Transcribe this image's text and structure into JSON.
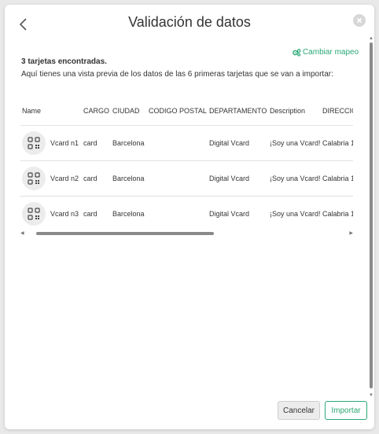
{
  "modal": {
    "title": "Validación de datos",
    "remap_label": "Cambiar mapeo",
    "found_text": "3 tarjetas encontradas.",
    "preview_text": "Aquí tienes una vista previa de los datos de las 6 primeras tarjetas que se van a importar:"
  },
  "table": {
    "headers": [
      "Name",
      "CARGO",
      "CIUDAD",
      "CODIGO POSTAL",
      "DEPARTAMENTO",
      "Description",
      "DIRECCIÓN"
    ],
    "rows": [
      {
        "name": "Vcard n1",
        "cargo": "card",
        "ciudad": "Barcelona",
        "cp": "",
        "departamento": "Digital Vcard",
        "description": "¡Soy una Vcard!",
        "direccion": "Calabria 1"
      },
      {
        "name": "Vcard n2",
        "cargo": "card",
        "ciudad": "Barcelona",
        "cp": "",
        "departamento": "Digital Vcard",
        "description": "¡Soy una Vcard!",
        "direccion": "Calabria 1"
      },
      {
        "name": "Vcard n3",
        "cargo": "card",
        "ciudad": "Barcelona",
        "cp": "",
        "departamento": "Digital Vcard",
        "description": "¡Soy una Vcard!",
        "direccion": "Calabria 1"
      }
    ]
  },
  "footer": {
    "cancel_label": "Cancelar",
    "import_label": "Importar"
  },
  "colors": {
    "accent": "#2aa876",
    "background": "#e9e9e9"
  },
  "icons": [
    "back-arrow-icon",
    "close-icon",
    "gears-icon",
    "qr-code-icon"
  ]
}
